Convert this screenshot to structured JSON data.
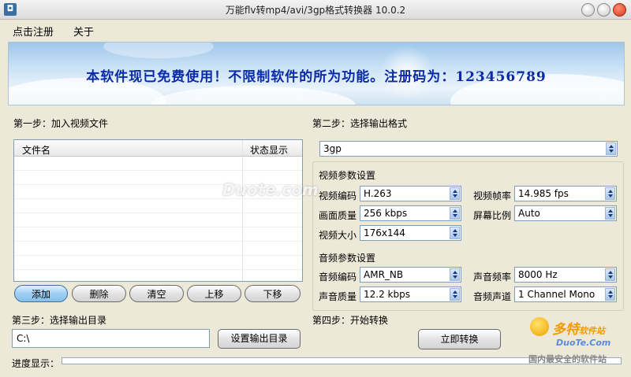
{
  "window": {
    "title": "万能flv转mp4/avi/3gp格式转换器 10.0.2"
  },
  "menu": {
    "items": [
      "点击注册",
      "关于"
    ]
  },
  "banner": {
    "text": "本软件现已免费使用！不限制软件的所为功能。注册码为：123456789"
  },
  "step1": {
    "label": "第一步：加入视频文件",
    "columns": [
      "文件名",
      "状态显示"
    ],
    "buttons": [
      "添加",
      "删除",
      "清空",
      "上移",
      "下移"
    ]
  },
  "step2": {
    "label": "第二步：选择输出格式",
    "format": "3gp",
    "video_group": "视频参数设置",
    "video_codec_label": "视频编码",
    "video_codec": "H.263",
    "frame_rate_label": "视频帧率",
    "frame_rate": "14.985 fps",
    "quality_label": "画面质量",
    "quality": "256 kbps",
    "aspect_label": "屏幕比例",
    "aspect": "Auto",
    "size_label": "视频大小",
    "size": "176x144",
    "audio_group": "音频参数设置",
    "audio_codec_label": "音频编码",
    "audio_codec": "AMR_NB",
    "sample_rate_label": "声音频率",
    "sample_rate": "8000 Hz",
    "audio_quality_label": "声音质量",
    "audio_quality": "12.2 kbps",
    "channels_label": "音频声道",
    "channels": "1 Channel Mono"
  },
  "step3": {
    "label": "第三步：选择输出目录",
    "path": "C:\\",
    "button": "设置输出目录"
  },
  "step4": {
    "label": "第四步：开始转换",
    "button": "立即转换"
  },
  "progress": {
    "label": "进度显示：",
    "value": 0
  },
  "watermark": {
    "site": "Duote.com",
    "brand": "多特",
    "brand_suffix": "软件站",
    "domain": "DuoTe.Com",
    "slogan": "国内最安全的软件站"
  },
  "colors": {
    "banner_text": "#0a2aa8",
    "active_button": "#9fcff3"
  }
}
